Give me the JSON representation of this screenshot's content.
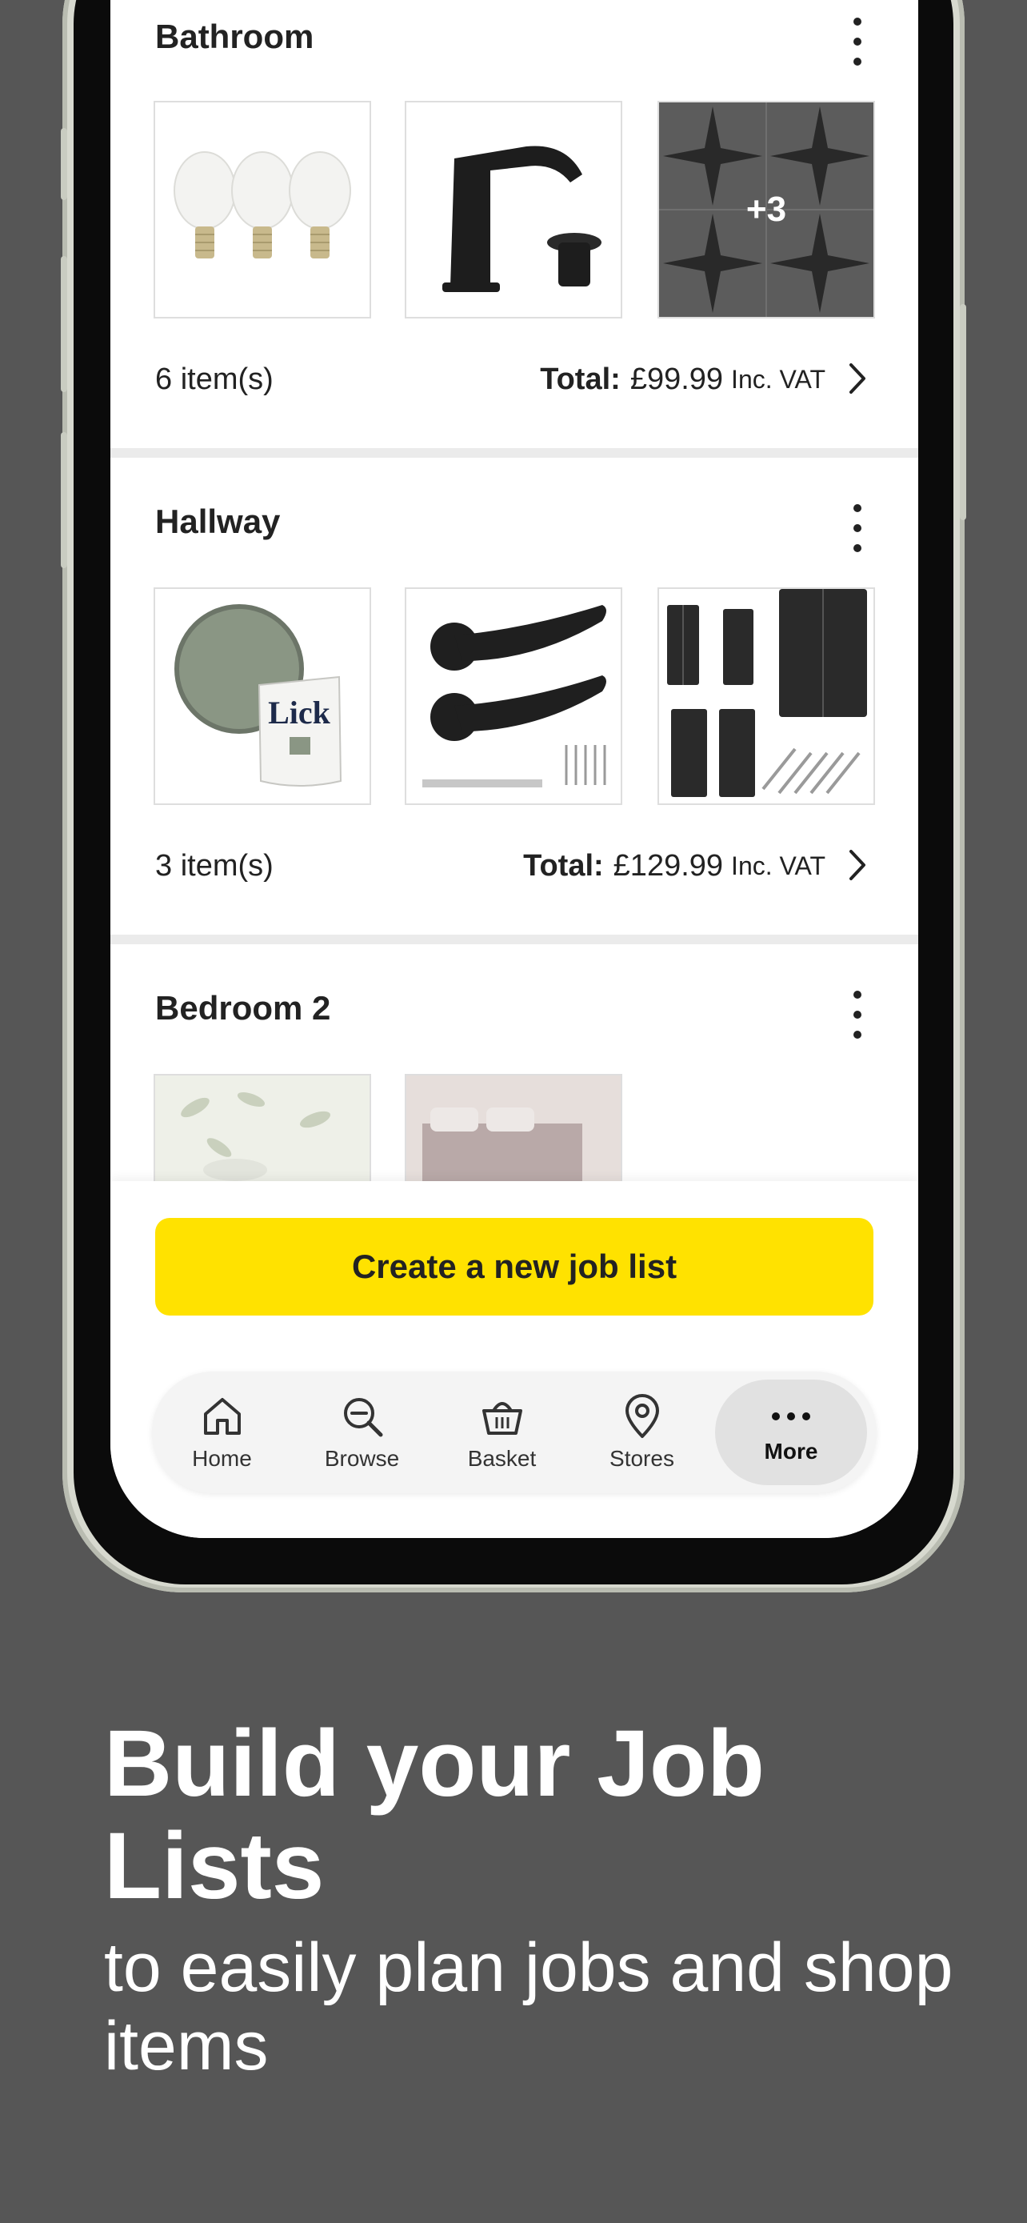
{
  "job_lists": [
    {
      "title": "Bathroom",
      "items": "6 item(s)",
      "total_label": "Total:",
      "price": "£99.99",
      "vat": "Inc. VAT",
      "more_count": "+3"
    },
    {
      "title": "Hallway",
      "items": "3 item(s)",
      "total_label": "Total:",
      "price": "£129.99",
      "vat": "Inc. VAT"
    },
    {
      "title": "Bedroom 2"
    }
  ],
  "cta_label": "Create a new job list",
  "nav": [
    {
      "label": "Home",
      "icon": "home-icon"
    },
    {
      "label": "Browse",
      "icon": "search-icon"
    },
    {
      "label": "Basket",
      "icon": "basket-icon"
    },
    {
      "label": "Stores",
      "icon": "location-pin-icon"
    },
    {
      "label": "More",
      "icon": "ellipsis-icon",
      "active": true
    }
  ],
  "promo": {
    "headline": "Build your Job Lists",
    "subline": "to easily plan jobs and shop items"
  },
  "colors": {
    "accent_yellow": "#ffe200",
    "background": "#565656"
  }
}
